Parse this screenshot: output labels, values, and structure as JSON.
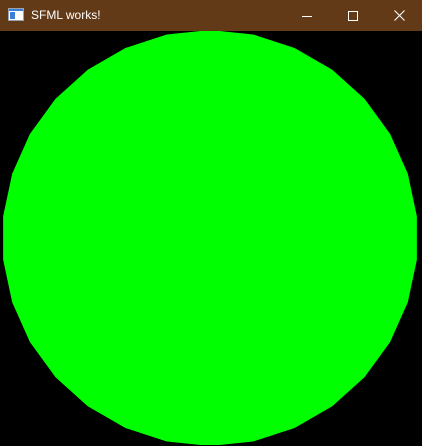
{
  "window": {
    "title": "SFML works!",
    "titlebar_color": "#633a17",
    "title_color": "#ffffff",
    "icons": {
      "app": "sfml-window-icon",
      "minimize": "minimize-icon",
      "maximize": "maximize-icon",
      "close": "close-icon"
    }
  },
  "scene": {
    "background_color": "#000000",
    "shape": {
      "type": "circle",
      "fill_color": "#00ff00"
    }
  }
}
